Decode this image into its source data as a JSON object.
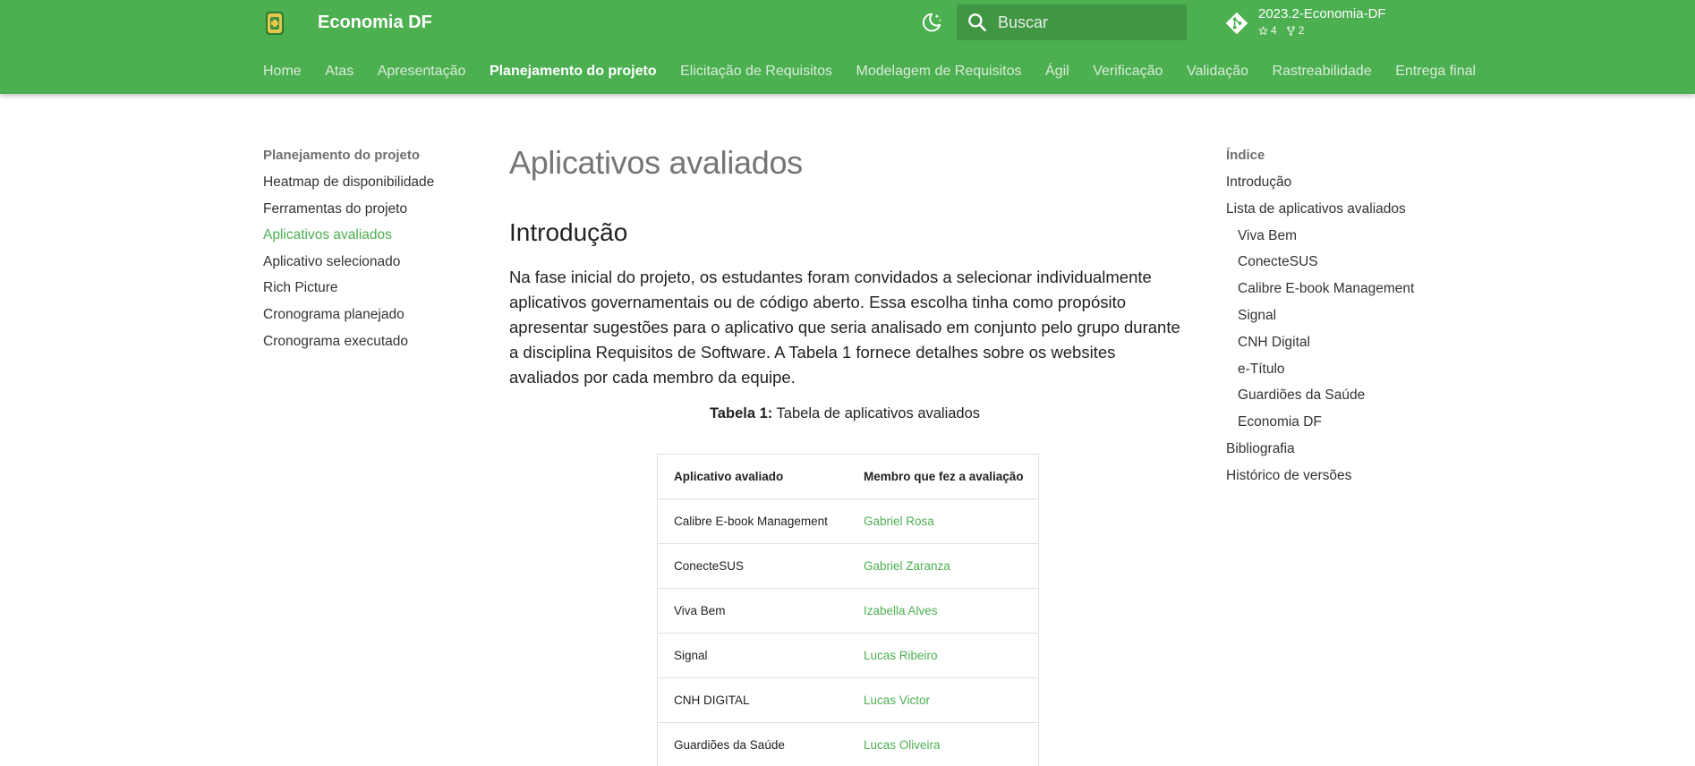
{
  "header": {
    "site_title": "Economia DF",
    "search_placeholder": "Buscar",
    "repo": {
      "name": "2023.2-Economia-DF",
      "stars": "4",
      "forks": "2"
    },
    "tabs": [
      {
        "label": "Home",
        "active": false
      },
      {
        "label": "Atas",
        "active": false
      },
      {
        "label": "Apresentação",
        "active": false
      },
      {
        "label": "Planejamento do projeto",
        "active": true
      },
      {
        "label": "Elicitação de Requisitos",
        "active": false
      },
      {
        "label": "Modelagem de Requisitos",
        "active": false
      },
      {
        "label": "Ágil",
        "active": false
      },
      {
        "label": "Verificação",
        "active": false
      },
      {
        "label": "Validação",
        "active": false
      },
      {
        "label": "Rastreabilidade",
        "active": false
      },
      {
        "label": "Entrega final",
        "active": false
      }
    ]
  },
  "left_nav": {
    "heading": "Planejamento do projeto",
    "items": [
      {
        "label": "Heatmap de disponibilidade",
        "active": false
      },
      {
        "label": "Ferramentas do projeto",
        "active": false
      },
      {
        "label": "Aplicativos avaliados",
        "active": true
      },
      {
        "label": "Aplicativo selecionado",
        "active": false
      },
      {
        "label": "Rich Picture",
        "active": false
      },
      {
        "label": "Cronograma planejado",
        "active": false
      },
      {
        "label": "Cronograma executado",
        "active": false
      }
    ]
  },
  "main": {
    "title": "Aplicativos avaliados",
    "section_title": "Introdução",
    "intro": "Na fase inicial do projeto, os estudantes foram convidados a selecionar individualmente aplicativos governamentais ou de código aberto. Essa escolha tinha como propósito apresentar sugestões para o aplicativo que seria analisado em conjunto pelo grupo durante a disciplina Requisitos de Software. A Tabela 1 fornece detalhes sobre os websites avaliados por cada membro da equipe.",
    "caption_label": "Tabela 1:",
    "caption_text": " Tabela de aplicativos avaliados",
    "table": {
      "headers": [
        "Aplicativo avaliado",
        "Membro que fez a avaliação"
      ],
      "rows": [
        [
          "Calibre E-book Management",
          "Gabriel Rosa"
        ],
        [
          "ConecteSUS",
          "Gabriel Zaranza"
        ],
        [
          "Viva Bem",
          "Izabella Alves"
        ],
        [
          "Signal",
          "Lucas Ribeiro"
        ],
        [
          "CNH DIGITAL",
          "Lucas Victor"
        ],
        [
          "Guardiões da Saúde",
          "Lucas Oliveira"
        ]
      ]
    }
  },
  "toc": {
    "heading": "Índice",
    "items": [
      {
        "label": "Introdução",
        "level": 1
      },
      {
        "label": "Lista de aplicativos avaliados",
        "level": 1
      },
      {
        "label": "Viva Bem",
        "level": 2
      },
      {
        "label": "ConecteSUS",
        "level": 2
      },
      {
        "label": "Calibre E-book Management",
        "level": 2
      },
      {
        "label": "Signal",
        "level": 2
      },
      {
        "label": "CNH Digital",
        "level": 2
      },
      {
        "label": "e-Título",
        "level": 2
      },
      {
        "label": "Guardiões da Saúde",
        "level": 2
      },
      {
        "label": "Economia DF",
        "level": 2
      },
      {
        "label": "Bibliografia",
        "level": 1
      },
      {
        "label": "Histórico de versões",
        "level": 1
      }
    ]
  },
  "colors": {
    "brand": "#4caf50",
    "link": "#4caf50",
    "header_text": "#ffffff"
  },
  "icons": {
    "logo": "app-logo-icon",
    "theme": "dark-mode-icon",
    "search": "search-icon",
    "repo": "git-icon",
    "stars": "star-icon",
    "forks": "fork-icon"
  }
}
